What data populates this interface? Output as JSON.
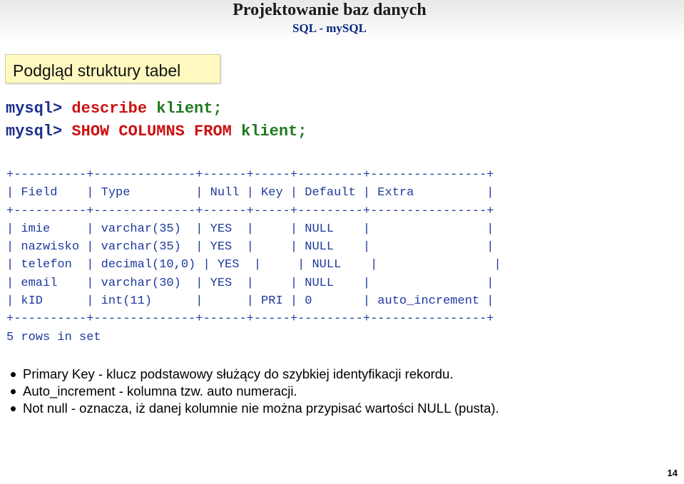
{
  "header": {
    "title": "Projektowanie baz danych",
    "subtitle": "SQL - mySQL"
  },
  "section": {
    "label": "Podgląd struktury tabel"
  },
  "commands": [
    {
      "prompt": "mysql>",
      "keyword": "describe",
      "table": "klient",
      "terminator": ";"
    },
    {
      "prompt": "mysql>",
      "keyword": "SHOW COLUMNS FROM",
      "table": "klient",
      "terminator": ";"
    }
  ],
  "describe_output": {
    "border_line": "+----------+--------------+------+-----+---------+----------------+",
    "columns": [
      "Field",
      "Type",
      "Null",
      "Key",
      "Default",
      "Extra"
    ],
    "rows": [
      [
        "imie",
        "varchar(35)",
        "YES",
        "",
        "NULL",
        ""
      ],
      [
        "nazwisko",
        "varchar(35)",
        "YES",
        "",
        "NULL",
        ""
      ],
      [
        "telefon",
        "decimal(10,0)",
        "YES",
        "",
        "NULL",
        ""
      ],
      [
        "email",
        "varchar(30)",
        "YES",
        "",
        "NULL",
        ""
      ],
      [
        "kID",
        "int(11)",
        "",
        "PRI",
        "0",
        "auto_increment"
      ]
    ],
    "footer": "5 rows in set"
  },
  "notes": [
    "Primary Key - klucz podstawowy służący do szybkiej identyfikacji rekordu.",
    "Auto_increment - kolumna tzw. auto numeracji.",
    "Not null - oznacza, iż danej kolumnie nie można przypisać wartości NULL (pusta)."
  ],
  "page_number": "14",
  "colors": {
    "title_subtitle": "#0a2a80",
    "section_box": "#fff9c0",
    "prompt": "#1c2e8c",
    "keyword": "#cc1111",
    "table_name": "#1f7a1f",
    "output_text": "#1e3a9c"
  }
}
